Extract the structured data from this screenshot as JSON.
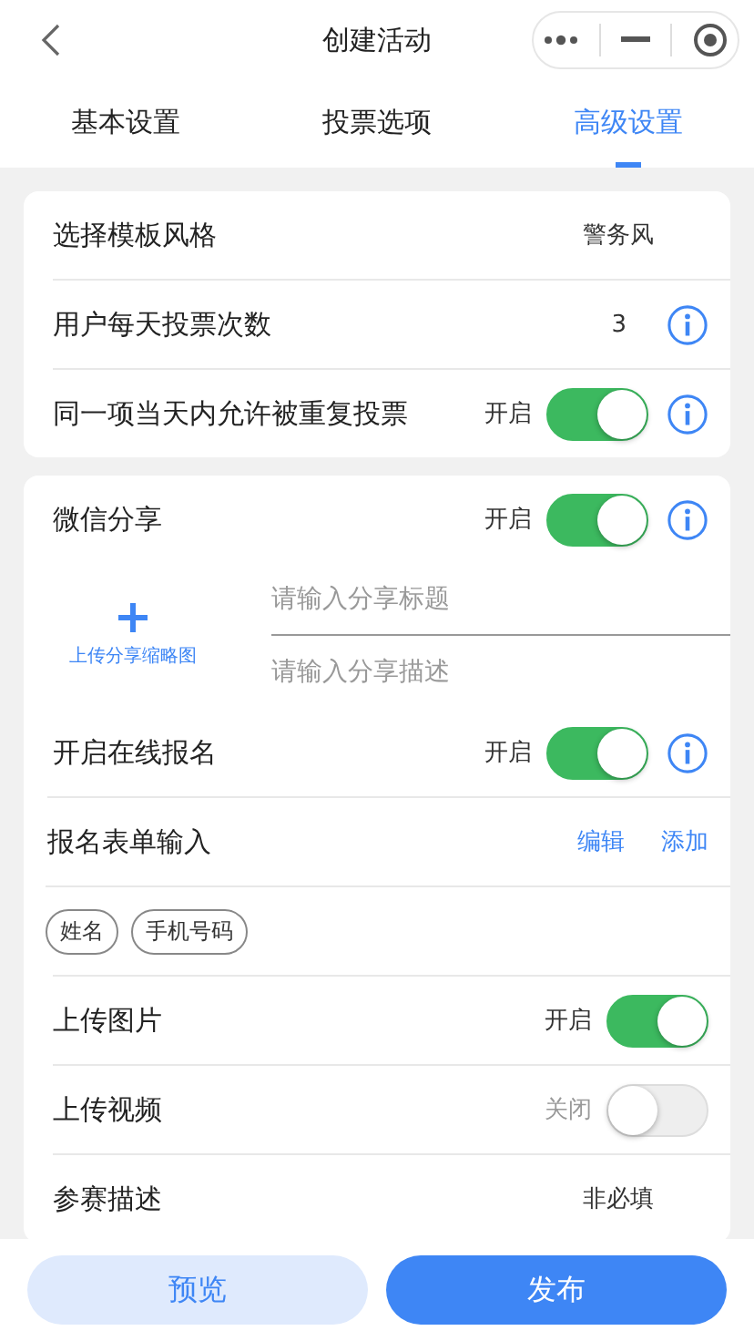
{
  "header": {
    "title": "创建活动"
  },
  "tabs": [
    {
      "label": "基本设置",
      "selected": false
    },
    {
      "label": "投票选项",
      "selected": false
    },
    {
      "label": "高级设置",
      "selected": true
    }
  ],
  "cards": [
    {
      "items": [
        {
          "kind": "value",
          "label": "选择模板风格",
          "value": "警务风",
          "info": false
        },
        {
          "kind": "value",
          "label": "用户每天投票次数",
          "value": "3",
          "info": true
        },
        {
          "kind": "toggle",
          "label": "同一项当天内允许被重复投票",
          "state_label": "开启",
          "on": true,
          "info": true
        }
      ]
    },
    {
      "items": [
        {
          "kind": "toggle",
          "label": "微信分享",
          "state_label": "开启",
          "on": true,
          "info": true
        },
        {
          "kind": "share",
          "upload_label": "上传分享缩略图",
          "title_placeholder": "请输入分享标题",
          "desc_placeholder": "请输入分享描述"
        },
        {
          "kind": "toggle",
          "label": "开启在线报名",
          "state_label": "开启",
          "on": true,
          "info": true
        },
        {
          "kind": "links",
          "label": "报名表单输入",
          "links": [
            "编辑",
            "添加"
          ]
        },
        {
          "kind": "tags",
          "tags": [
            "姓名",
            "手机号码"
          ]
        },
        {
          "kind": "toggle",
          "label": "上传图片",
          "state_label": "开启",
          "on": true,
          "info": false
        },
        {
          "kind": "toggle",
          "label": "上传视频",
          "state_label": "关闭",
          "on": false,
          "info": false
        },
        {
          "kind": "value",
          "label": "参赛描述",
          "value": "非必填",
          "info": false
        }
      ]
    }
  ],
  "footer": {
    "buttons": [
      {
        "label": "预览",
        "kind": "secondary"
      },
      {
        "label": "发布",
        "kind": "primary"
      }
    ]
  }
}
